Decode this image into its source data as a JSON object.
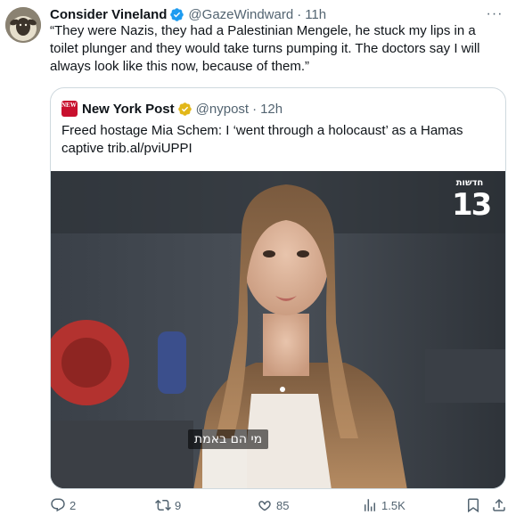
{
  "tweet": {
    "author_name": "Consider Vineland",
    "handle": "@GazeWindward",
    "separator": "·",
    "time": "11h",
    "more_label": "···",
    "text": "“They were Nazis, they had a Palestinian Mengele, he stuck my lips in a toilet plunger and they would take turns pumping it. The doctors say I will always look like this now, because of them.”"
  },
  "quote": {
    "author_name": "New York Post",
    "logo_text": "NEW YORK POST",
    "handle": "@nypost",
    "separator": "·",
    "time": "12h",
    "text": "Freed hostage Mia Schem: I ‘went through a holocaust’ as a Hamas captive trib.al/pviUPPI",
    "video": {
      "subtitle": "מי הם באמת",
      "channel_top": "חדשות",
      "channel_number": "13"
    }
  },
  "actions": {
    "replies": "2",
    "reposts": "9",
    "likes": "85",
    "views": "1.5K"
  },
  "colors": {
    "verified_blue": "#1d9bf0",
    "verified_gold": "#e2b719",
    "muted_text": "#536471",
    "nyp_red": "#c8102e",
    "border": "#cfd9de"
  },
  "icons": {
    "reply": "reply-icon",
    "repost": "repost-icon",
    "like": "heart-icon",
    "views": "views-icon",
    "bookmark": "bookmark-icon",
    "share": "share-icon",
    "more": "more-icon"
  }
}
